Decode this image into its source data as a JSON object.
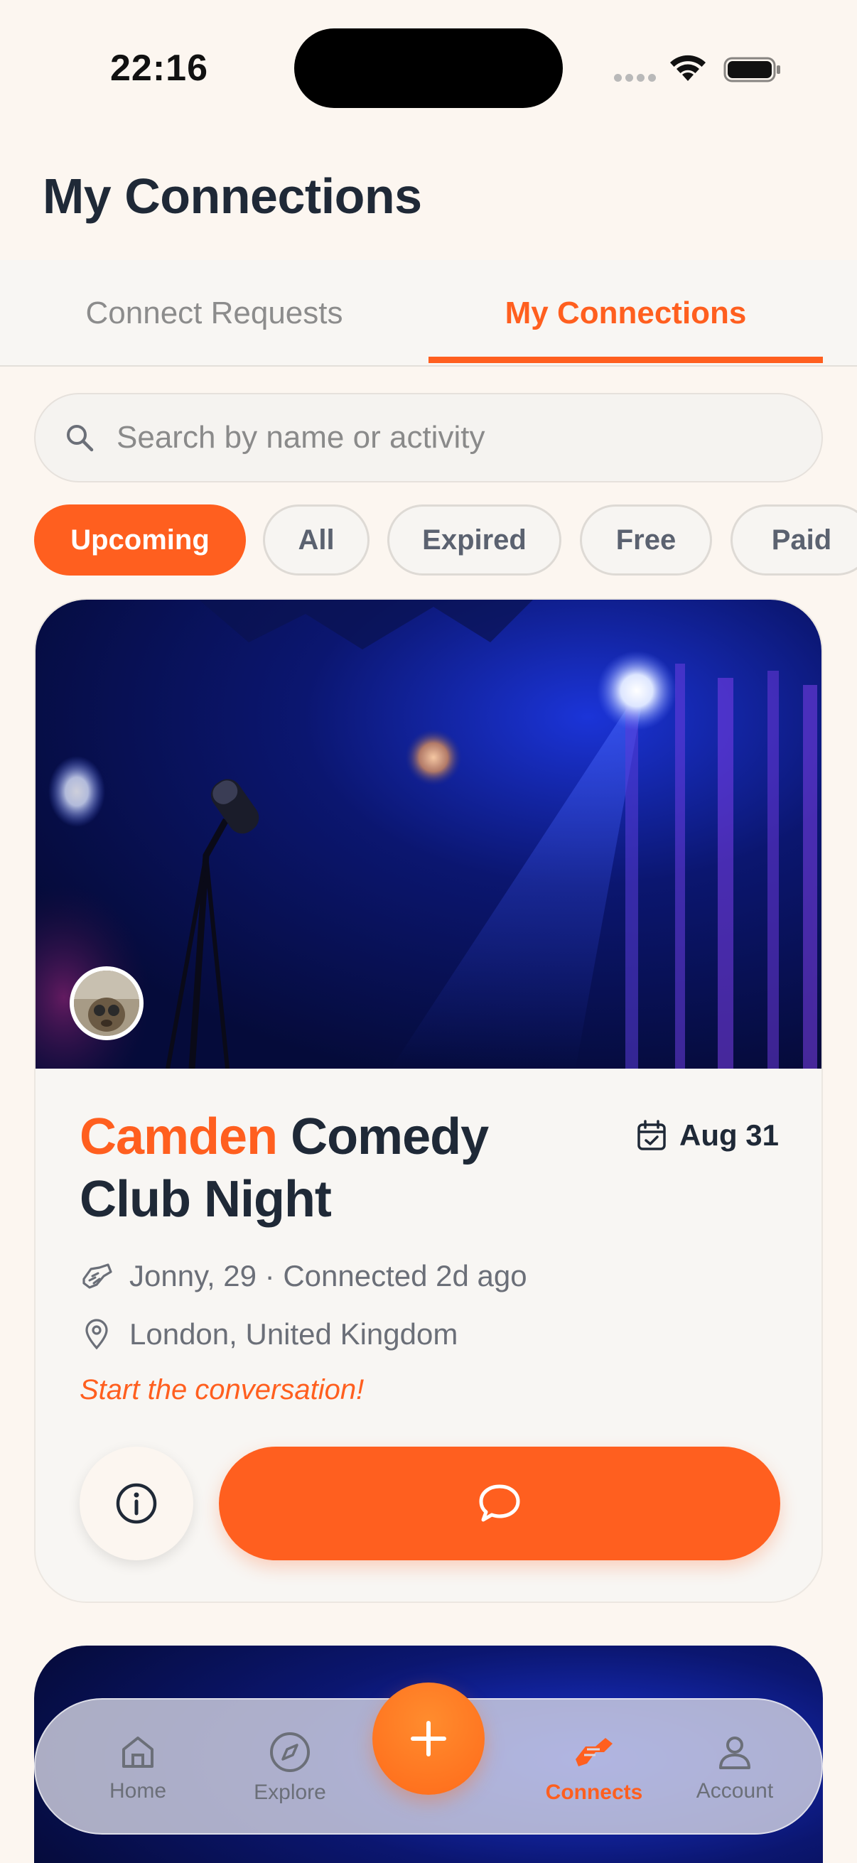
{
  "status_bar": {
    "time": "22:16"
  },
  "page": {
    "title": "My Connections"
  },
  "tabs": [
    {
      "label": "Connect Requests",
      "active": false
    },
    {
      "label": "My Connections",
      "active": true
    }
  ],
  "search": {
    "placeholder": "Search by name or activity",
    "value": ""
  },
  "filters": [
    {
      "label": "Upcoming",
      "active": true
    },
    {
      "label": "All",
      "active": false
    },
    {
      "label": "Expired",
      "active": false
    },
    {
      "label": "Free",
      "active": false
    },
    {
      "label": "Paid",
      "active": false
    }
  ],
  "card": {
    "title_accent": "Camden",
    "title_rest": "Comedy Club Night",
    "date": "Aug 31",
    "connection": "Jonny, 29 · Connected 2d ago",
    "location": "London, United Kingdom",
    "cta": "Start the conversation!"
  },
  "tabbar": {
    "items": [
      {
        "label": "Home",
        "icon": "home-icon",
        "active": false
      },
      {
        "label": "Explore",
        "icon": "compass-icon",
        "active": false
      },
      {
        "label": "Connects",
        "icon": "connects-icon",
        "active": true
      },
      {
        "label": "Account",
        "icon": "account-icon",
        "active": false
      }
    ]
  },
  "colors": {
    "accent": "#FF5F1F",
    "background": "#FCF6F0",
    "text": "#1F2937"
  }
}
